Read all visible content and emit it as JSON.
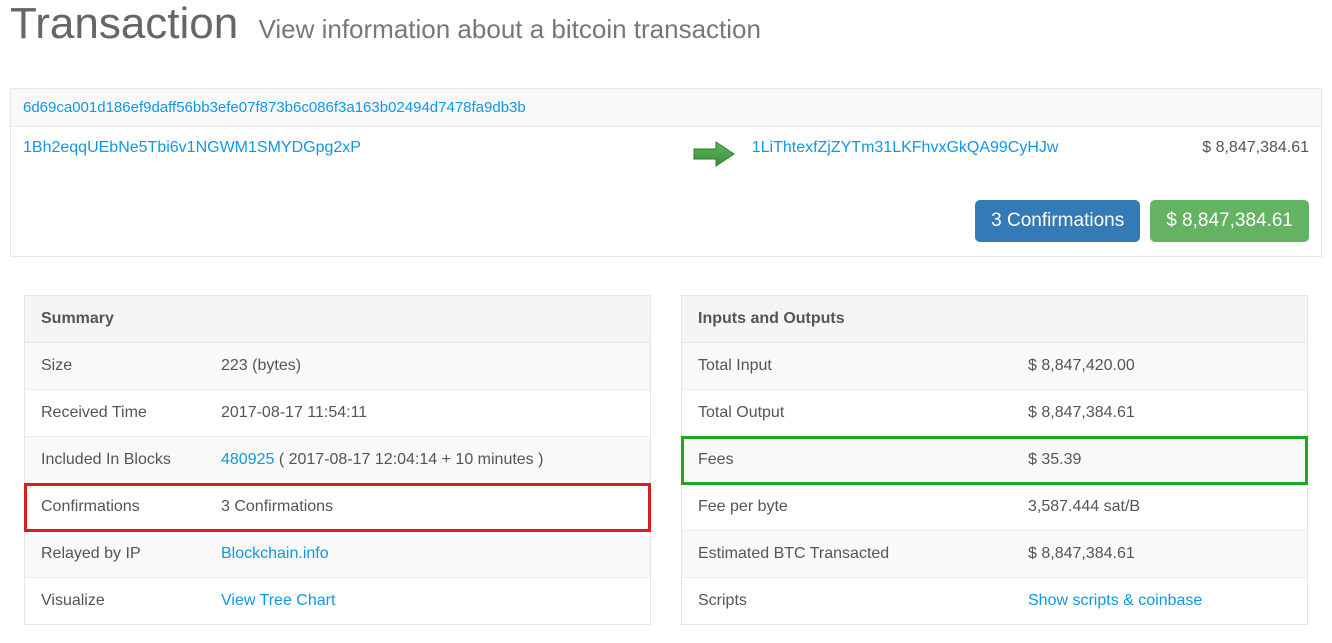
{
  "header": {
    "title": "Transaction",
    "subtitle": "View information about a bitcoin transaction"
  },
  "tx": {
    "hash": "6d69ca001d186ef9daff56bb3efe07f873b6c086f3a163b02494d7478fa9db3b",
    "input_address": "1Bh2eqqUEbNe5Tbi6v1NGWM1SMYDGpg2xP",
    "output_address": "1LiThtexfZjZYTm31LKFhvxGkQA99CyHJw",
    "output_amount": "$ 8,847,384.61",
    "confirmations_badge": "3 Confirmations",
    "total_badge": "$ 8,847,384.61"
  },
  "summary": {
    "title": "Summary",
    "rows": {
      "size": {
        "k": "Size",
        "v": "223 (bytes)"
      },
      "received_time": {
        "k": "Received Time",
        "v": "2017-08-17 11:54:11"
      },
      "included": {
        "k": "Included In Blocks",
        "block": "480925",
        "suffix": " ( 2017-08-17 12:04:14 + 10 minutes )"
      },
      "confirmations": {
        "k": "Confirmations",
        "v": "3 Confirmations"
      },
      "relayed": {
        "k": "Relayed by IP",
        "v": "Blockchain.info"
      },
      "visualize": {
        "k": "Visualize",
        "v": "View Tree Chart"
      }
    }
  },
  "io": {
    "title": "Inputs and Outputs",
    "rows": {
      "total_input": {
        "k": "Total Input",
        "v": "$ 8,847,420.00"
      },
      "total_output": {
        "k": "Total Output",
        "v": "$ 8,847,384.61"
      },
      "fees": {
        "k": "Fees",
        "v": "$ 35.39"
      },
      "fee_per_byte": {
        "k": "Fee per byte",
        "v": "3,587.444 sat/B"
      },
      "est_btc": {
        "k": "Estimated BTC Transacted",
        "v": "$ 8,847,384.61"
      },
      "scripts": {
        "k": "Scripts",
        "v": "Show scripts & coinbase"
      }
    }
  }
}
